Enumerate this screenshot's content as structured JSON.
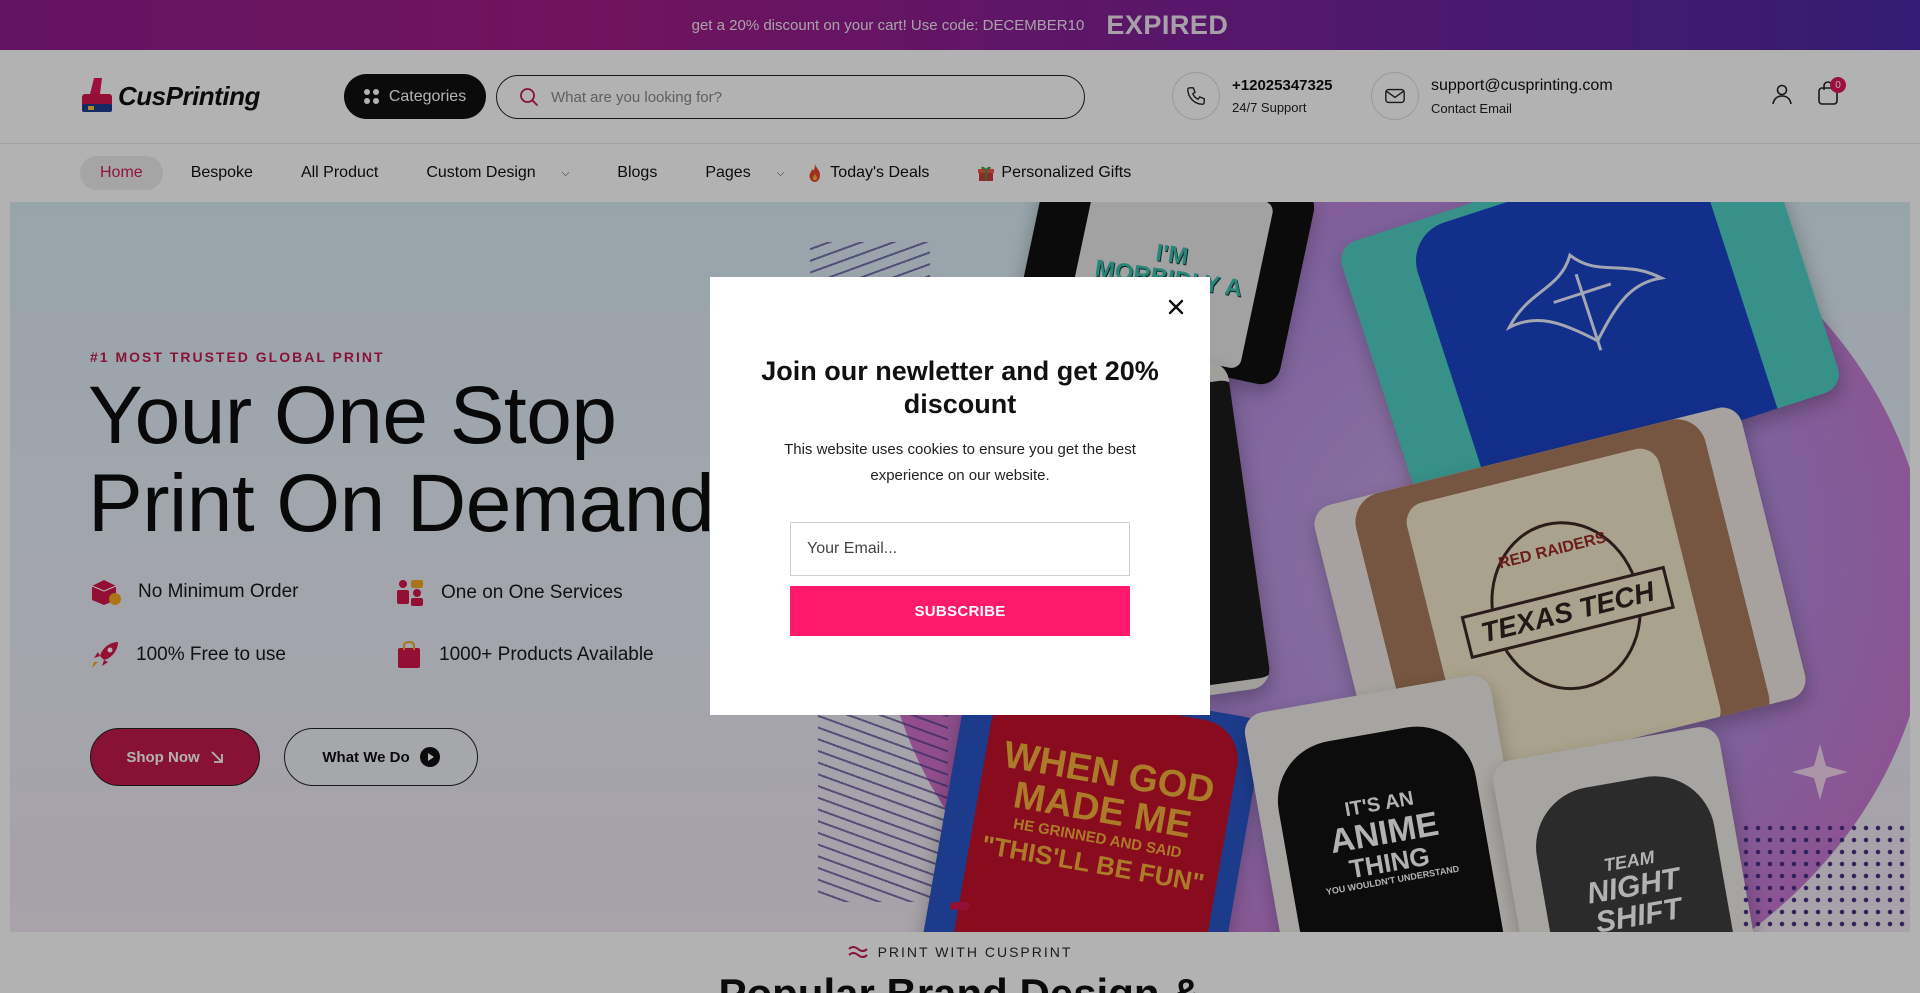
{
  "promo": {
    "message": "get a 20% discount on your cart! Use code: DECEMBER10",
    "status": "EXPIRED"
  },
  "header": {
    "logo_text": "CusPrinting",
    "categories_label": "Categories",
    "search_placeholder": "What are you looking for?",
    "phone": {
      "value": "+12025347325",
      "label": "24/7 Support",
      "icon": "phone-icon"
    },
    "email": {
      "value": "support@cusprinting.com",
      "label": "Contact Email",
      "icon": "mail-icon"
    },
    "cart_count": "0"
  },
  "nav": {
    "home": "Home",
    "bespoke": "Bespoke",
    "all_product": "All Product",
    "custom_design": "Custom Design",
    "blogs": "Blogs",
    "pages": "Pages",
    "todays_deals": "Today's Deals",
    "personalized_gifts": "Personalized Gifts"
  },
  "hero": {
    "tag": "#1 MOST TRUSTED GLOBAL PRINT",
    "title_line1": "Your One Stop",
    "title_line2": "Print On Demand",
    "features": {
      "no_min": "No Minimum Order",
      "one_on_one": "One on One Services",
      "free": "100% Free to use",
      "products": "1000+ Products Available"
    },
    "shop_now": "Shop Now",
    "what_we_do": "What We Do",
    "shirts": {
      "beast": "I'M MORBIDLY A BEAST",
      "god_line1": "WHEN GOD",
      "god_line2": "MADE ME",
      "god_line3": "HE GRINNED AND SAID",
      "god_line4": "\"THIS'LL BE FUN\"",
      "texas_top": "RED RAIDERS",
      "texas_main": "TEXAS TECH",
      "anime_line1": "IT'S AN",
      "anime_line2": "ANIME",
      "anime_line3": "THING",
      "anime_line4": "YOU WOULDN'T UNDERSTAND",
      "night_line1": "TEAM",
      "night_line2": "NIGHT",
      "night_line3": "SHIFT"
    }
  },
  "section": {
    "tag": "PRINT WITH CUSPRINT",
    "title": "Popular Brand Design &"
  },
  "modal": {
    "title": "Join our newletter and get 20% discount",
    "description": "This website uses cookies to ensure you get the best experience on our website.",
    "email_placeholder": "Your Email...",
    "subscribe": "SUBSCRIBE"
  },
  "colors": {
    "accent": "#c31a4d",
    "subscribe": "#ff1a6c",
    "badge": "#e0185e"
  }
}
